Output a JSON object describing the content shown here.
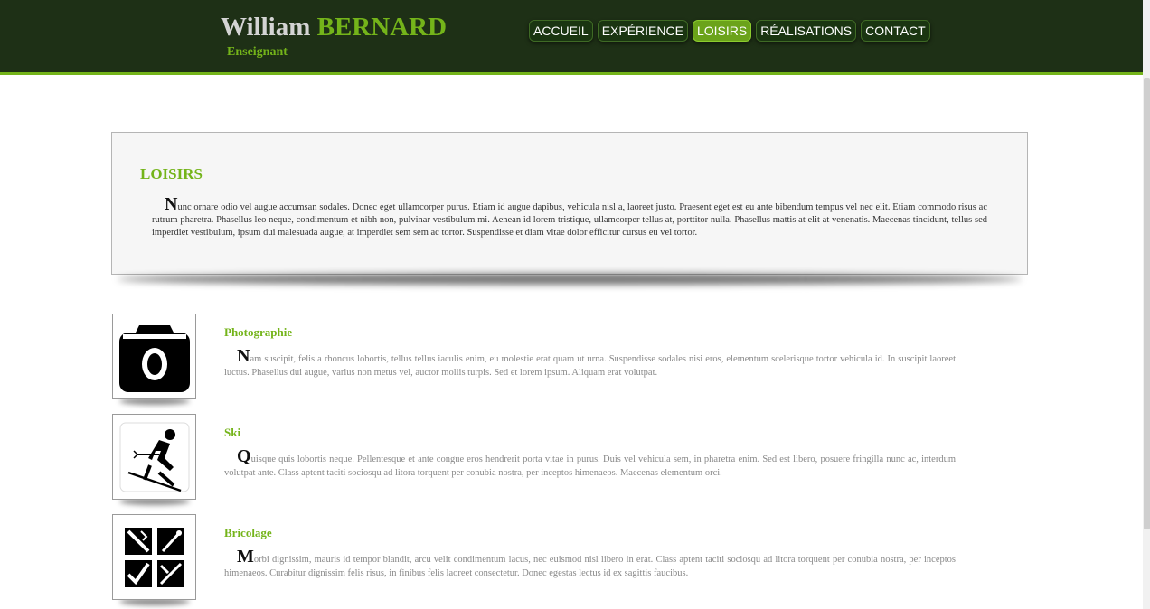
{
  "header": {
    "first_name": "William",
    "last_name": "BERNARD",
    "tagline": "Enseignant"
  },
  "nav": [
    {
      "label": "ACCUEIL"
    },
    {
      "label": "EXPÉRIENCE"
    },
    {
      "label": "LOISIRS",
      "active": true
    },
    {
      "label": "RÉALISATIONS"
    },
    {
      "label": "CONTACT"
    }
  ],
  "intro": {
    "title": "LOISIRS",
    "dropcap": "N",
    "text": "unc ornare odio vel augue accumsan sodales. Donec eget ullamcorper purus. Etiam id augue dapibus, vehicula nisl a, laoreet justo. Praesent eget est eu ante bibendum tempus vel nec elit. Etiam commodo risus ac rutrum pharetra. Phasellus leo neque, condimentum et nibh non, pulvinar vestibulum mi. Aenean id lorem tristique, ullamcorper tellus at, porttitor nulla. Phasellus mattis at elit at venenatis. Maecenas tincidunt, tellus sed imperdiet vestibulum, ipsum dui malesuada augue, at imperdiet sem sem ac tortor. Suspendisse et diam vitae dolor efficitur cursus eu vel tortor."
  },
  "hobbies": [
    {
      "title": "Photographie",
      "icon": "camera-icon",
      "dropcap": "N",
      "text": "am suscipit, felis a rhoncus lobortis, tellus tellus iaculis enim, eu molestie erat quam ut urna. Suspendisse sodales nisi eros, elementum scelerisque tortor vehicula id. In suscipit laoreet luctus. Phasellus dui augue, varius non metus vel, auctor mollis turpis. Sed et lorem ipsum. Aliquam erat volutpat."
    },
    {
      "title": "Ski",
      "icon": "skier-icon",
      "dropcap": "Q",
      "text": "uisque quis lobortis neque. Pellentesque et ante congue eros hendrerit porta vitae in purus. Duis vel vehicula sem, in pharetra enim. Sed est libero, posuere fringilla nunc ac, interdum volutpat ante. Class aptent taciti sociosqu ad litora torquent per conubia nostra, per inceptos himenaeos. Maecenas elementum orci."
    },
    {
      "title": "Bricolage",
      "icon": "tools-icon",
      "dropcap": "M",
      "text": "orbi dignissim, mauris id tempor blandit, arcu velit condimentum lacus, nec euismod nisl libero in erat. Class aptent taciti sociosqu ad litora torquent per conubia nostra, per inceptos himenaeos. Curabitur dignissim felis risus, in finibus felis laoreet consectetur. Donec egestas lectus id ex sagittis faucibus."
    }
  ],
  "colors": {
    "header_bg": "#1e3016",
    "accent": "#74b41a",
    "active_nav": "#6ba31a"
  }
}
